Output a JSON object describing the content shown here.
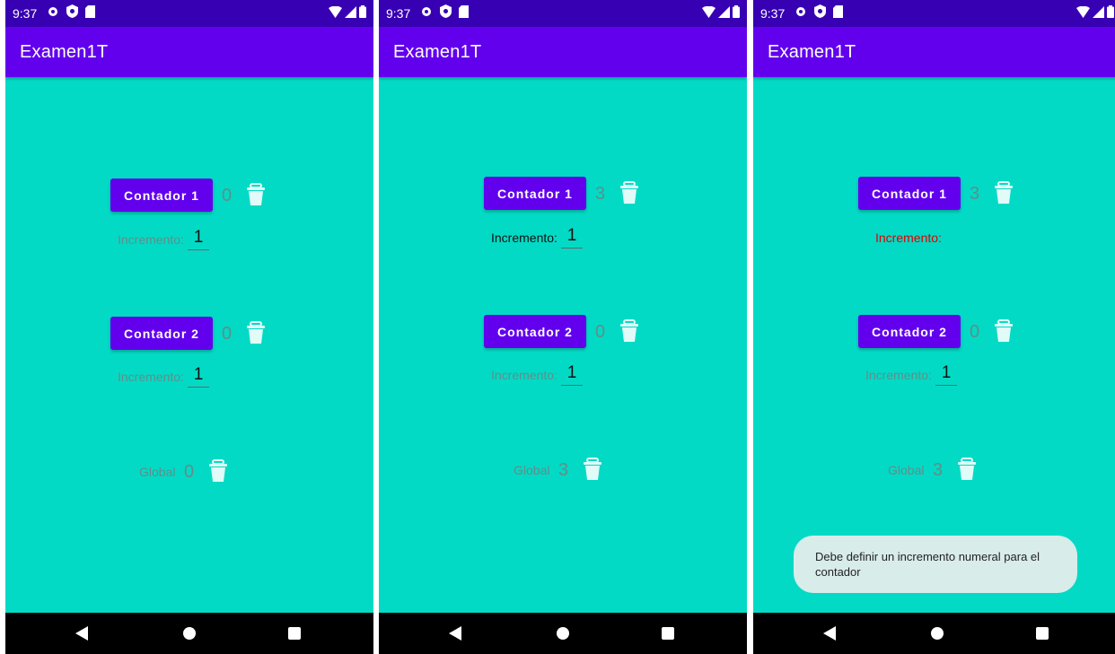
{
  "colors": {
    "status_bar": "#3700B3",
    "app_bar": "#6200EE",
    "background": "#03DAC5",
    "button": "#6200EE",
    "error_text": "#e00000",
    "trash_icon": "#e0fbf8"
  },
  "screens": [
    {
      "status": {
        "time": "9:37"
      },
      "title": "Examen1T",
      "counter1": {
        "button": "Contador 1",
        "value": "0",
        "inc_label": "Incremento:",
        "inc_value": "1"
      },
      "counter2": {
        "button": "Contador 2",
        "value": "0",
        "inc_label": "Incremento:",
        "inc_value": "1"
      },
      "global": {
        "label": "Global",
        "value": "0"
      }
    },
    {
      "status": {
        "time": "9:37"
      },
      "title": "Examen1T",
      "counter1": {
        "button": "Contador 1",
        "value": "3",
        "inc_label": "Incremento:",
        "inc_value": "1"
      },
      "counter2": {
        "button": "Contador 2",
        "value": "0",
        "inc_label": "Incremento:",
        "inc_value": "1"
      },
      "global": {
        "label": "Global",
        "value": "3"
      }
    },
    {
      "status": {
        "time": "9:37"
      },
      "title": "Examen1T",
      "counter1": {
        "button": "Contador 1",
        "value": "3",
        "inc_label": "Incremento:",
        "inc_value": ""
      },
      "counter2": {
        "button": "Contador 2",
        "value": "0",
        "inc_label": "Incremento:",
        "inc_value": "1"
      },
      "global": {
        "label": "Global",
        "value": "3"
      },
      "toast": "Debe definir un incremento numeral para el contador"
    }
  ],
  "icons": {
    "status": [
      "settings-icon",
      "shield-icon",
      "sd-card-icon"
    ],
    "status_right": [
      "wifi-icon",
      "signal-icon",
      "battery-icon"
    ],
    "trash": "trash-icon",
    "nav": [
      "back-icon",
      "home-icon",
      "recents-icon"
    ]
  }
}
